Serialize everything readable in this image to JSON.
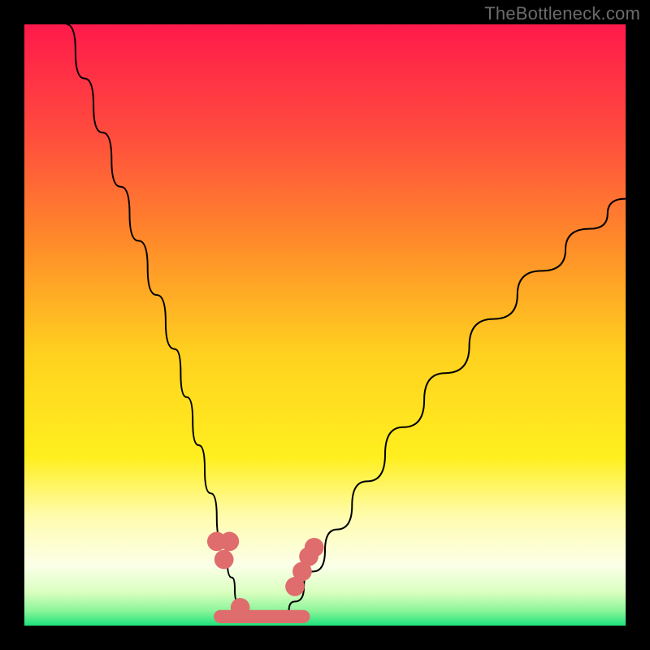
{
  "watermark": {
    "text": "TheBottleneck.com"
  },
  "chart_data": {
    "type": "line",
    "title": "",
    "xlabel": "",
    "ylabel": "",
    "xlim": [
      0,
      100
    ],
    "ylim": [
      0,
      100
    ],
    "grid": false,
    "legend": false,
    "gradient_stops": [
      {
        "offset": 0,
        "color": "#ff1a4b"
      },
      {
        "offset": 0.18,
        "color": "#ff4b3e"
      },
      {
        "offset": 0.36,
        "color": "#ff8a2a"
      },
      {
        "offset": 0.55,
        "color": "#ffd21f"
      },
      {
        "offset": 0.72,
        "color": "#ffef1f"
      },
      {
        "offset": 0.82,
        "color": "#fffcb0"
      },
      {
        "offset": 0.9,
        "color": "#fbffe8"
      },
      {
        "offset": 0.945,
        "color": "#d9ffbf"
      },
      {
        "offset": 0.975,
        "color": "#8cf59a"
      },
      {
        "offset": 1.0,
        "color": "#1de27a"
      }
    ],
    "series": [
      {
        "name": "left-curve",
        "color": "#000000",
        "width": 2,
        "x": [
          7,
          10,
          13,
          16,
          19,
          22,
          25,
          27,
          29,
          31,
          33,
          34.5,
          35.5,
          36.5
        ],
        "y": [
          100,
          91,
          82,
          73,
          64,
          55,
          46,
          38,
          30,
          22,
          14,
          8,
          4,
          1
        ]
      },
      {
        "name": "right-curve",
        "color": "#000000",
        "width": 2,
        "x": [
          43,
          45,
          48,
          52,
          57,
          63,
          70,
          78,
          86,
          94,
          100
        ],
        "y": [
          1,
          4,
          9,
          16,
          24,
          33,
          42,
          51,
          59,
          66,
          71
        ]
      }
    ],
    "floor_band": {
      "color": "#e06d6d",
      "xstart": 31.5,
      "xend": 47.5,
      "y": 1.5,
      "thickness": 2.2
    },
    "markers": {
      "color": "#e06d6d",
      "r": 1.6,
      "points": [
        {
          "x": 32.0,
          "y": 14.0
        },
        {
          "x": 33.2,
          "y": 11.0
        },
        {
          "x": 34.1,
          "y": 14.0
        },
        {
          "x": 35.9,
          "y": 3.0
        },
        {
          "x": 45.0,
          "y": 6.5
        },
        {
          "x": 46.2,
          "y": 9.0
        },
        {
          "x": 47.3,
          "y": 11.5
        },
        {
          "x": 48.2,
          "y": 13.0
        }
      ]
    }
  }
}
